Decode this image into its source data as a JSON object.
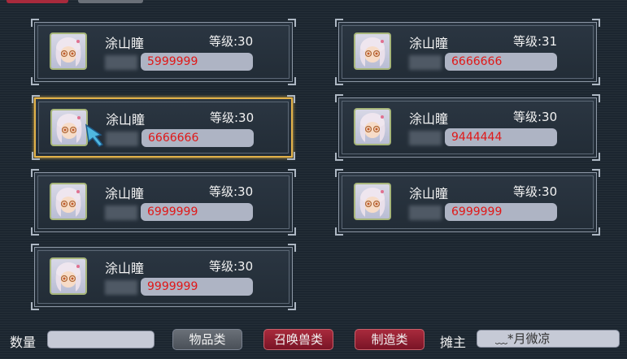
{
  "colors": {
    "price_text": "#e01818",
    "selected_border": "#e2b24a",
    "button_red": "#a82a3c"
  },
  "listings": [
    {
      "name": "涂山瞳",
      "level": "等级:30",
      "price": "5999999",
      "selected": false
    },
    {
      "name": "涂山瞳",
      "level": "等级:31",
      "price": "6666666",
      "selected": false
    },
    {
      "name": "涂山瞳",
      "level": "等级:30",
      "price": "6666666",
      "selected": true
    },
    {
      "name": "涂山瞳",
      "level": "等级:30",
      "price": "9444444",
      "selected": false
    },
    {
      "name": "涂山瞳",
      "level": "等级:30",
      "price": "6999999",
      "selected": false
    },
    {
      "name": "涂山瞳",
      "level": "等级:30",
      "price": "6999999",
      "selected": false
    },
    {
      "name": "涂山瞳",
      "level": "等级:30",
      "price": "9999999",
      "selected": false
    }
  ],
  "filter": {
    "quantity_label": "数量",
    "quantity_value": "",
    "categories": [
      "物品类",
      "召唤兽类",
      "制造类"
    ],
    "seller_label": "摊主",
    "seller_name": "﹏*月微凉"
  }
}
